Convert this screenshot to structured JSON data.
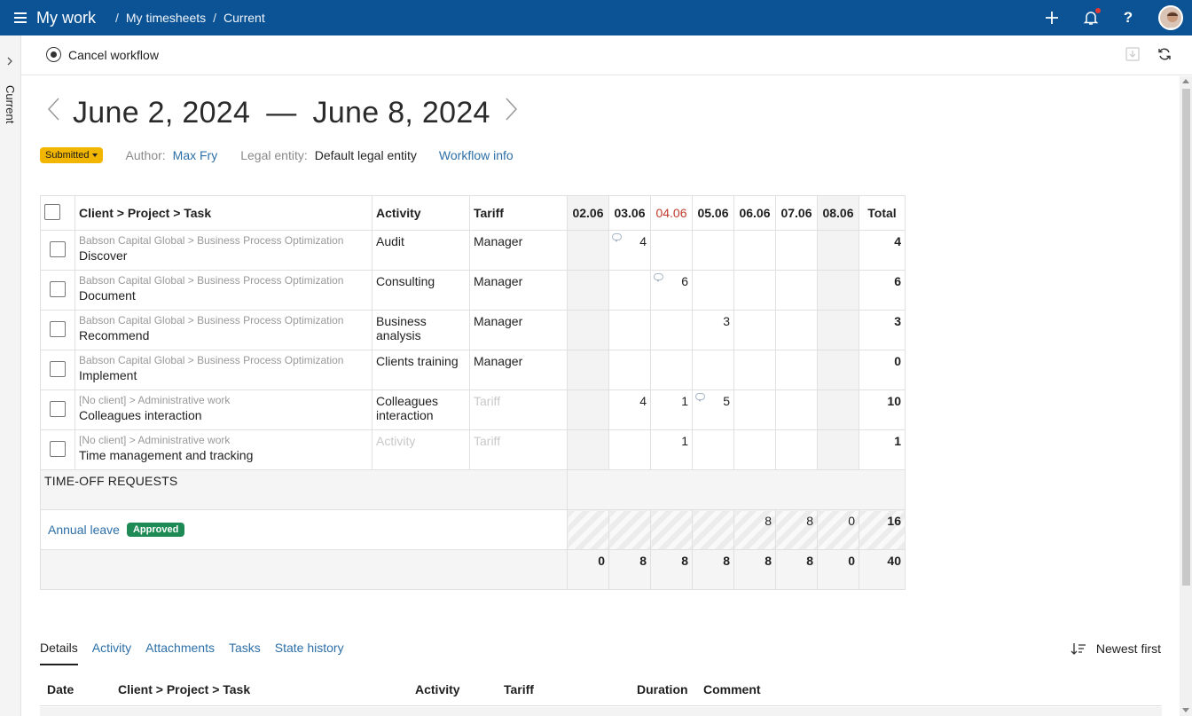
{
  "header": {
    "app_title": "My work",
    "breadcrumb": [
      "My timesheets",
      "Current"
    ],
    "breadcrumb_sep": "/"
  },
  "sidebar": {
    "label": "Current"
  },
  "toolbar": {
    "cancel_label": "Cancel workflow"
  },
  "period": {
    "start": "June 2, 2024",
    "dash": "—",
    "end": "June 8, 2024"
  },
  "meta": {
    "status": "Submitted",
    "author_label": "Author:",
    "author": "Max Fry",
    "legal_label": "Legal entity:",
    "legal_entity": "Default legal entity",
    "workflow_link": "Workflow info"
  },
  "grid": {
    "columns": {
      "task": "Client > Project > Task",
      "activity": "Activity",
      "tariff": "Tariff",
      "total": "Total"
    },
    "days": [
      "02.06",
      "03.06",
      "04.06",
      "05.06",
      "06.06",
      "07.06",
      "08.06"
    ],
    "rows": [
      {
        "path": "Babson Capital Global > Business Process Optimization",
        "task": "Discover",
        "activity": "Audit",
        "tariff": "Manager",
        "hours": [
          "",
          "4",
          "",
          "",
          "",
          "",
          ""
        ],
        "total": "4"
      },
      {
        "path": "Babson Capital Global > Business Process Optimization",
        "task": "Document",
        "activity": "Consulting",
        "tariff": "Manager",
        "hours": [
          "",
          "",
          "6",
          "",
          "",
          "",
          ""
        ],
        "total": "6"
      },
      {
        "path": "Babson Capital Global > Business Process Optimization",
        "task": "Recommend",
        "activity": "Business analysis",
        "tariff": "Manager",
        "hours": [
          "",
          "",
          "",
          "3",
          "",
          "",
          ""
        ],
        "total": "3"
      },
      {
        "path": "Babson Capital Global > Business Process Optimization",
        "task": "Implement",
        "activity": "Clients training",
        "tariff": "Manager",
        "hours": [
          "",
          "",
          "",
          "",
          "",
          "",
          ""
        ],
        "total": "0"
      },
      {
        "path": "[No client] > Administrative work",
        "task": "Colleagues interaction",
        "activity": "Colleagues interaction",
        "tariff": "Tariff",
        "hours": [
          "",
          "4",
          "1",
          "5",
          "",
          "",
          ""
        ],
        "total": "10"
      },
      {
        "path": "[No client] > Administrative work",
        "task": "Time management and tracking",
        "activity": "Activity",
        "tariff": "Tariff",
        "hours": [
          "",
          "",
          "1",
          "",
          "",
          "",
          ""
        ],
        "total": "1"
      }
    ],
    "timeoff_title": "TIME-OFF REQUESTS",
    "leave": {
      "label": "Annual leave",
      "status": "Approved",
      "hours": [
        "",
        "",
        "",
        "",
        "8",
        "8",
        "0"
      ],
      "total": "16"
    },
    "totals": {
      "hours": [
        "0",
        "8",
        "8",
        "8",
        "8",
        "8",
        "0"
      ],
      "total": "40"
    }
  },
  "tabs": [
    "Details",
    "Activity",
    "Attachments",
    "Tasks",
    "State history"
  ],
  "sort_label": "Newest first",
  "details_columns": {
    "date": "Date",
    "task": "Client > Project > Task",
    "activity": "Activity",
    "tariff": "Tariff",
    "duration": "Duration",
    "comment": "Comment"
  },
  "colors": {
    "topbar": "#0b5394",
    "submitted": "#f2b600",
    "approved": "#1e8a55",
    "link": "#2d6fa8",
    "holiday": "#c0392b"
  }
}
